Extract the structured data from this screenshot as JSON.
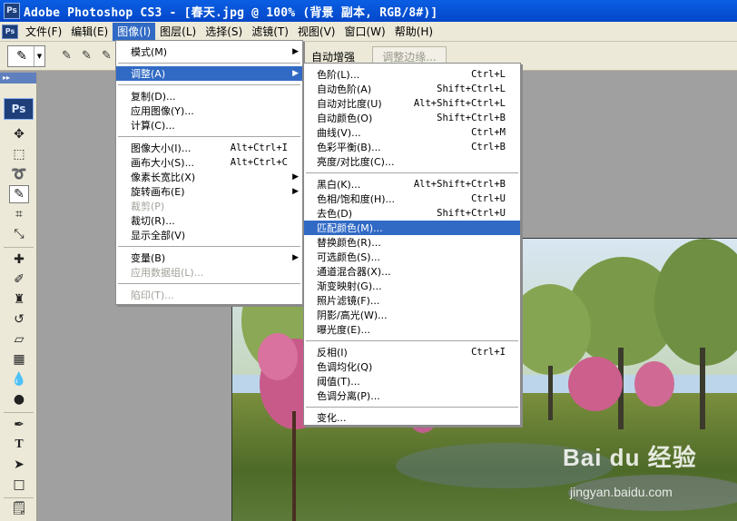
{
  "window": {
    "badge": "Ps",
    "title": "Adobe Photoshop CS3 - [春天.jpg @ 100% (背景 副本, RGB/8#)]"
  },
  "menubar": {
    "icon": "Ps",
    "items": [
      {
        "label": "文件(F)"
      },
      {
        "label": "编辑(E)"
      },
      {
        "label": "图像(I)"
      },
      {
        "label": "图层(L)"
      },
      {
        "label": "选择(S)"
      },
      {
        "label": "滤镜(T)"
      },
      {
        "label": "视图(V)"
      },
      {
        "label": "窗口(W)"
      },
      {
        "label": "帮助(H)"
      }
    ]
  },
  "options_bar": {
    "auto_enhance": "自动增强",
    "refine_edge": "调整边缘..."
  },
  "toolbox": {
    "logo": "Ps",
    "tools": [
      "move-tool",
      "marquee-tool",
      "lasso-tool",
      "quick-selection-tool",
      "crop-tool",
      "eyedropper-tool",
      "healing-brush-tool",
      "brush-tool",
      "clone-stamp-tool",
      "history-brush-tool",
      "eraser-tool",
      "gradient-tool",
      "blur-tool",
      "dodge-tool",
      "pen-tool",
      "type-tool",
      "path-selection-tool",
      "shape-tool",
      "notes-tool"
    ]
  },
  "image_menu": {
    "items": [
      {
        "label": "模式(M)",
        "submenu": true
      },
      {
        "label": "调整(A)",
        "submenu": true,
        "highlighted": true
      },
      {
        "label": "复制(D)..."
      },
      {
        "label": "应用图像(Y)..."
      },
      {
        "label": "计算(C)..."
      },
      {
        "label": "图像大小(I)...",
        "shortcut": "Alt+Ctrl+I"
      },
      {
        "label": "画布大小(S)...",
        "shortcut": "Alt+Ctrl+C"
      },
      {
        "label": "像素长宽比(X)",
        "submenu": true
      },
      {
        "label": "旋转画布(E)",
        "submenu": true
      },
      {
        "label": "裁剪(P)",
        "disabled": true
      },
      {
        "label": "裁切(R)..."
      },
      {
        "label": "显示全部(V)"
      },
      {
        "label": "变量(B)",
        "submenu": true
      },
      {
        "label": "应用数据组(L)...",
        "disabled": true
      },
      {
        "label": "陷印(T)...",
        "disabled": true
      }
    ]
  },
  "adjust_menu": {
    "items": [
      {
        "label": "色阶(L)...",
        "shortcut": "Ctrl+L"
      },
      {
        "label": "自动色阶(A)",
        "shortcut": "Shift+Ctrl+L"
      },
      {
        "label": "自动对比度(U)",
        "shortcut": "Alt+Shift+Ctrl+L"
      },
      {
        "label": "自动颜色(O)",
        "shortcut": "Shift+Ctrl+B"
      },
      {
        "label": "曲线(V)...",
        "shortcut": "Ctrl+M"
      },
      {
        "label": "色彩平衡(B)...",
        "shortcut": "Ctrl+B"
      },
      {
        "label": "亮度/对比度(C)..."
      },
      {
        "label": "黑白(K)...",
        "shortcut": "Alt+Shift+Ctrl+B"
      },
      {
        "label": "色相/饱和度(H)...",
        "shortcut": "Ctrl+U"
      },
      {
        "label": "去色(D)",
        "shortcut": "Shift+Ctrl+U"
      },
      {
        "label": "匹配颜色(M)...",
        "highlighted": true
      },
      {
        "label": "替换颜色(R)..."
      },
      {
        "label": "可选颜色(S)..."
      },
      {
        "label": "通道混合器(X)..."
      },
      {
        "label": "渐变映射(G)..."
      },
      {
        "label": "照片滤镜(F)..."
      },
      {
        "label": "阴影/高光(W)..."
      },
      {
        "label": "曝光度(E)..."
      },
      {
        "label": "反相(I)",
        "shortcut": "Ctrl+I"
      },
      {
        "label": "色调均化(Q)"
      },
      {
        "label": "阈值(T)..."
      },
      {
        "label": "色调分离(P)..."
      },
      {
        "label": "变化..."
      }
    ]
  },
  "watermark": {
    "logo": "Bai du 经验",
    "url": "jingyan.baidu.com"
  },
  "colors": {
    "titlebar": "#0347c9",
    "menu_highlight": "#316ac5",
    "chrome": "#ece9d8",
    "workspace": "#a0a0a0"
  }
}
